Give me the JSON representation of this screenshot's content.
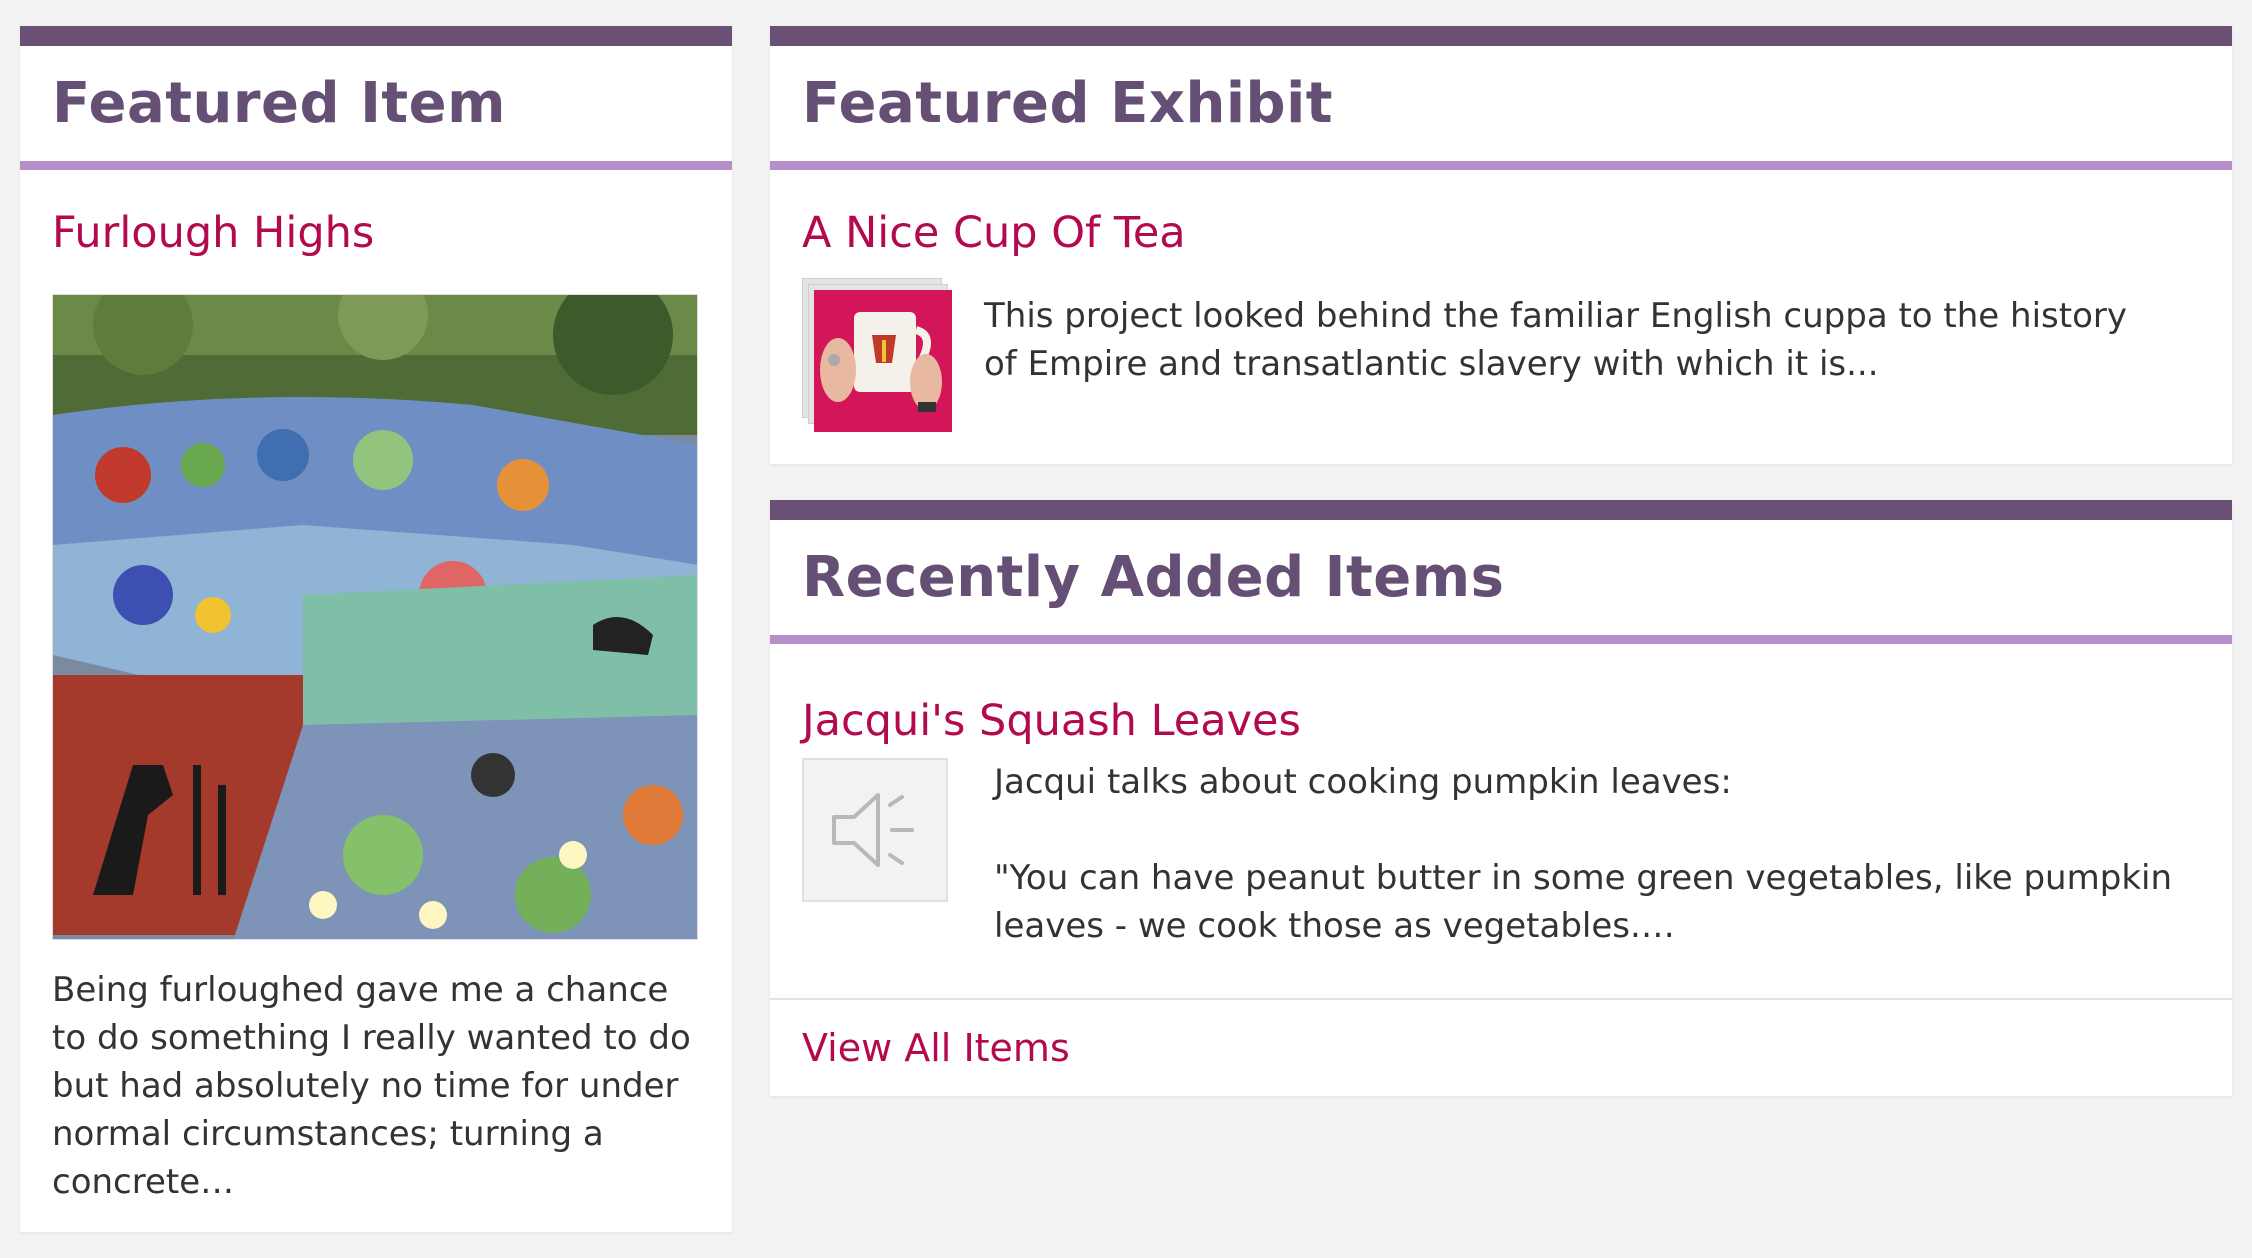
{
  "featured_item": {
    "heading": "Featured Item",
    "title": "Furlough Highs",
    "image_alt": "Mosaic bench",
    "description": "Being furloughed gave me a chance to do something I really wanted to do but had absolutely no time for under normal circumstances; turning a concrete…"
  },
  "featured_exhibit": {
    "heading": "Featured Exhibit",
    "title": "A Nice Cup Of Tea",
    "description": "This project looked behind the familiar English cuppa to the history of Empire and transatlantic slavery with which it is..."
  },
  "recent_items": {
    "heading": "Recently Added Items",
    "item_title": "Jacqui's Squash Leaves",
    "item_intro": "Jacqui talks about cooking pumpkin leaves:",
    "item_quote": "\"You can have peanut butter in some green vegetables, like pumpkin leaves - we cook those as vegetables.…",
    "view_all_label": "View All Items"
  },
  "colors": {
    "header_bar": "#6b5075",
    "header_underline": "#b48fc9",
    "heading_text": "#654f74",
    "link": "#b3094f"
  },
  "icons": {
    "audio": "speaker-icon"
  }
}
